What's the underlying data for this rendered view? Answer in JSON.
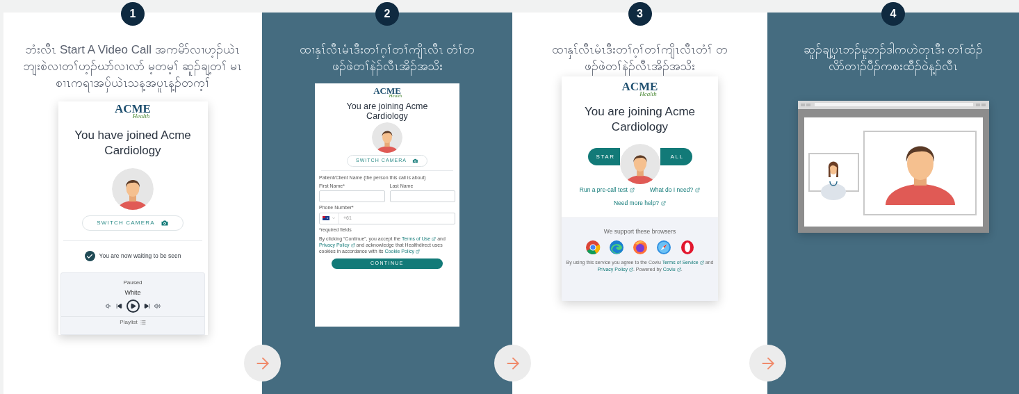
{
  "steps": [
    {
      "number": "1",
      "caption": "ဘံးလီၤ Start A Video Call အကမိာ်လၢဟ့ၣ်ယဲၤ ဘျးစဲလၢတၢ်ဟ့ၣ်ဃာ်လၢလာ် မ့တမ့ၢ် ဆူၣ်ချ့တၢ် မၤစၢၤကရၢအပှ်ယဲၤသန့အပူၤန့ၣ်တက့ၢ်",
      "screen": {
        "kind": "waiting",
        "logo": {
          "name": "ACME",
          "tagline": "Health"
        },
        "title": "You have joined Acme Cardiology",
        "camera_button": "SWITCH CAMERA",
        "status": "You are now waiting to be seen",
        "player": {
          "state": "Paused",
          "track": "White",
          "playlist": "Playlist"
        }
      }
    },
    {
      "number": "2",
      "caption": "ထၢနှၤ်လီၤမံၤဒီးတၢ်ဂ့ၢ်တၢ်ကျိၤလီၤ တံၢ်တဖၣ်ဖဲတၢ်နဲၣ်လီၤအိၣ်အသိး",
      "screen": {
        "kind": "form",
        "logo": {
          "name": "ACME",
          "tagline": "Health"
        },
        "title": "You are joining Acme Cardiology",
        "camera_button": "SWITCH CAMERA",
        "section_label": "Patient/Client Name (the person this call is about)",
        "fields": [
          {
            "label": "First Name*"
          },
          {
            "label": "Last Name"
          }
        ],
        "phone": {
          "label": "Phone Number*",
          "placeholder": "+61"
        },
        "required_note": "*required fields",
        "consent": [
          {
            "kind": "text",
            "text": "By clicking “Continue”, you accept the"
          },
          {
            "kind": "link",
            "text": "Terms of Use"
          },
          {
            "kind": "text",
            "text": "and"
          },
          {
            "kind": "link",
            "text": "Privacy Policy"
          },
          {
            "kind": "text",
            "text": "and acknowledge that Healthdirect uses cookies in accordance with its"
          },
          {
            "kind": "link",
            "text": "Cookie Policy"
          }
        ],
        "submit": "CONTINUE"
      }
    },
    {
      "number": "3",
      "caption": "ထၢနှၤ်လီၤမံၤဒီးတၢ်ဂ့ၢ်တၢ်ကျိၤလီၤတံၢ် တဖၣ်ဖဲတၢ်နဲၣ်လီၤအိၣ်အသိး",
      "screen": {
        "kind": "join",
        "logo": {
          "name": "ACME",
          "tagline": "Health"
        },
        "title": "You are joining Acme Cardiology",
        "call_button": {
          "left": "STAR",
          "right": "ALL"
        },
        "links": [
          "Run a pre-call test",
          "What do I need?",
          "Need more help?"
        ],
        "browsers_heading": "We support these browsers",
        "browsers": [
          {
            "kind": "chrome"
          },
          {
            "kind": "edge"
          },
          {
            "kind": "firefox"
          },
          {
            "kind": "safari"
          },
          {
            "kind": "opera"
          }
        ],
        "footer": [
          {
            "kind": "text",
            "text": "By using this service you agree to the Coviu"
          },
          {
            "kind": "link",
            "text": "Terms of Service"
          },
          {
            "kind": "text",
            "text": "and"
          },
          {
            "kind": "link",
            "text": "Privacy Policy"
          },
          {
            "kind": "text",
            "text": ". Powered by"
          },
          {
            "kind": "link",
            "text": "Coviu"
          },
          {
            "kind": "text",
            "text": "."
          }
        ]
      }
    },
    {
      "number": "4",
      "caption": "ဆူၣ်ချ့ပှၤဘၣ်မူဘၣ်ဒါကဟဲတုၤဒီး တၢ်ထံၣ်လိာ်တၢၣ်ပီၣ်ကစးထီၣ်ဝဲန့ၣ်လီၤ",
      "screen": {
        "kind": "video"
      }
    }
  ]
}
